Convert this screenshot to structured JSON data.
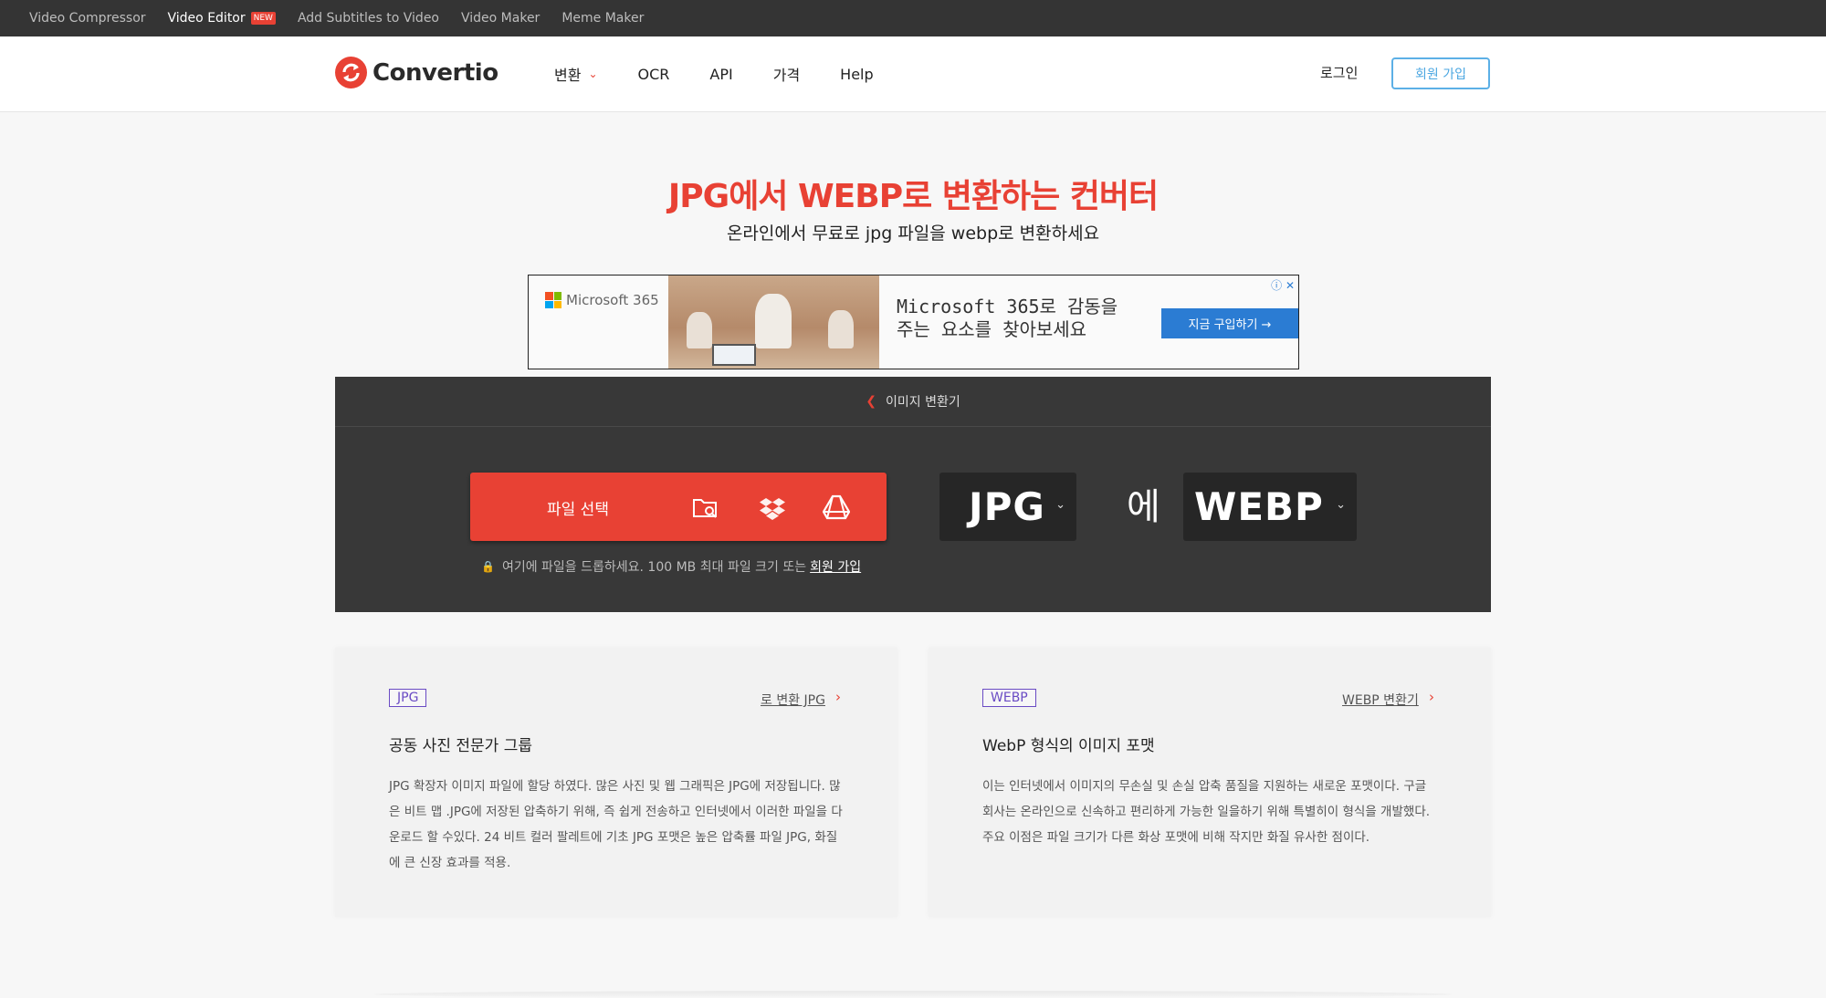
{
  "topbar": {
    "links": [
      {
        "label": "Video Compressor"
      },
      {
        "label": "Video Editor",
        "badge": "NEW"
      },
      {
        "label": "Add Subtitles to Video"
      },
      {
        "label": "Video Maker"
      },
      {
        "label": "Meme Maker"
      }
    ]
  },
  "header": {
    "logo_text": "Convertio",
    "nav": [
      {
        "label": "변환"
      },
      {
        "label": "OCR"
      },
      {
        "label": "API"
      },
      {
        "label": "가격"
      },
      {
        "label": "Help"
      }
    ],
    "login": "로그인",
    "signup": "회원 가입"
  },
  "hero": {
    "title": "JPG에서 WEBP로 변환하는 컨버터",
    "subtitle": "온라인에서 무료로 jpg 파일을 webp로 변환하세요"
  },
  "ad": {
    "brand": "Microsoft 365",
    "headline_line1": "Microsoft 365로 감동을",
    "headline_line2": "주는 요소를 찾아보세요",
    "cta": "지금 구입하기 →",
    "close": "ⓘ ✕"
  },
  "converter": {
    "breadcrumb": "이미지 변환기",
    "choose_files": "파일 선택",
    "drop_hint": "여기에 파일을 드롭하세요. 100 MB 최대 파일 크기 또는",
    "drop_hint_link": "회원 가입",
    "from_format": "JPG",
    "to_word": "에",
    "to_format": "WEBP"
  },
  "cards": [
    {
      "badge": "JPG",
      "link": "로 변환 JPG",
      "title": "공동 사진 전문가 그룹",
      "description": "JPG 확장자 이미지 파일에 할당 하였다. 많은 사진 및 웹 그래픽은 JPG에 저장됩니다. 많은 비트 맵 .JPG에 저장된 압축하기 위해, 즉 쉽게 전송하고 인터넷에서 이러한 파일을 다운로드 할 수있다. 24 비트 컬러 팔레트에 기초 JPG 포맷은 높은 압축률 파일 JPG, 화질에 큰 신장 효과를 적용."
    },
    {
      "badge": "WEBP",
      "link": "WEBP 변환기",
      "title": "WebP 형식의 이미지 포맷",
      "description": "이는 인터넷에서 이미지의 무손실 및 손실 압축 품질을 지원하는 새로운 포맷이다. 구글 회사는 온라인으로 신속하고 편리하게 가능한 일을하기 위해 특별히이 형식을 개발했다. 주요 이점은 파일 크기가 다른 화상 포맷에 비해 작지만 화질 유사한 점이다."
    }
  ],
  "colors": {
    "brand_red": "#e84134",
    "panel_dark": "#383838",
    "signup_blue": "#4aa6e1",
    "badge_purple": "#6a4bc4"
  }
}
